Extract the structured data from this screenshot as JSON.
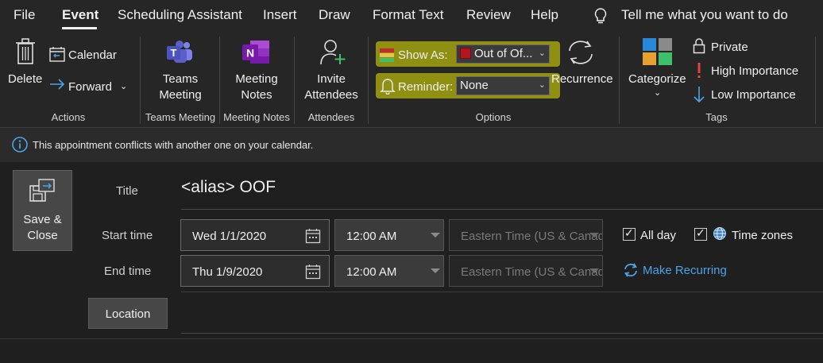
{
  "menu": {
    "tabs": [
      "File",
      "Event",
      "Scheduling Assistant",
      "Insert",
      "Draw",
      "Format Text",
      "Review",
      "Help"
    ],
    "active_tab": "Event",
    "tell_me": "Tell me what you want to do"
  },
  "ribbon": {
    "actions": {
      "delete": "Delete",
      "calendar": "Calendar",
      "forward": "Forward",
      "group": "Actions"
    },
    "teams": {
      "button_line1": "Teams",
      "button_line2": "Meeting",
      "group": "Teams Meeting"
    },
    "notes": {
      "button_line1": "Meeting",
      "button_line2": "Notes",
      "group": "Meeting Notes"
    },
    "attendees": {
      "button_line1": "Invite",
      "button_line2": "Attendees",
      "group": "Attendees"
    },
    "options": {
      "show_as_label": "Show As:",
      "show_as_value": "Out of Of...",
      "reminder_label": "Reminder:",
      "reminder_value": "None",
      "recurrence": "Recurrence",
      "group": "Options"
    },
    "tags": {
      "categorize": "Categorize",
      "private": "Private",
      "high_importance": "High Importance",
      "low_importance": "Low Importance",
      "group": "Tags"
    }
  },
  "infobar": {
    "message": "This appointment conflicts with another one on your calendar."
  },
  "form": {
    "save_line1": "Save &",
    "save_line2": "Close",
    "title_label": "Title",
    "title_value": "<alias> OOF",
    "start_label": "Start time",
    "start_date": "Wed 1/1/2020",
    "start_time": "12:00 AM",
    "start_tz": "Eastern Time (US & Canada)",
    "end_label": "End time",
    "end_date": "Thu 1/9/2020",
    "end_time": "12:00 AM",
    "end_tz": "Eastern Time (US & Canada)",
    "all_day": "All day",
    "all_day_checked": true,
    "time_zones": "Time zones",
    "time_zones_checked": true,
    "make_recurring": "Make Recurring",
    "location_button": "Location"
  },
  "colors": {
    "accent_blue": "#4aa3e6",
    "highlight_yellow": "#e5e800",
    "out_of_office_red": "#b4141e"
  }
}
